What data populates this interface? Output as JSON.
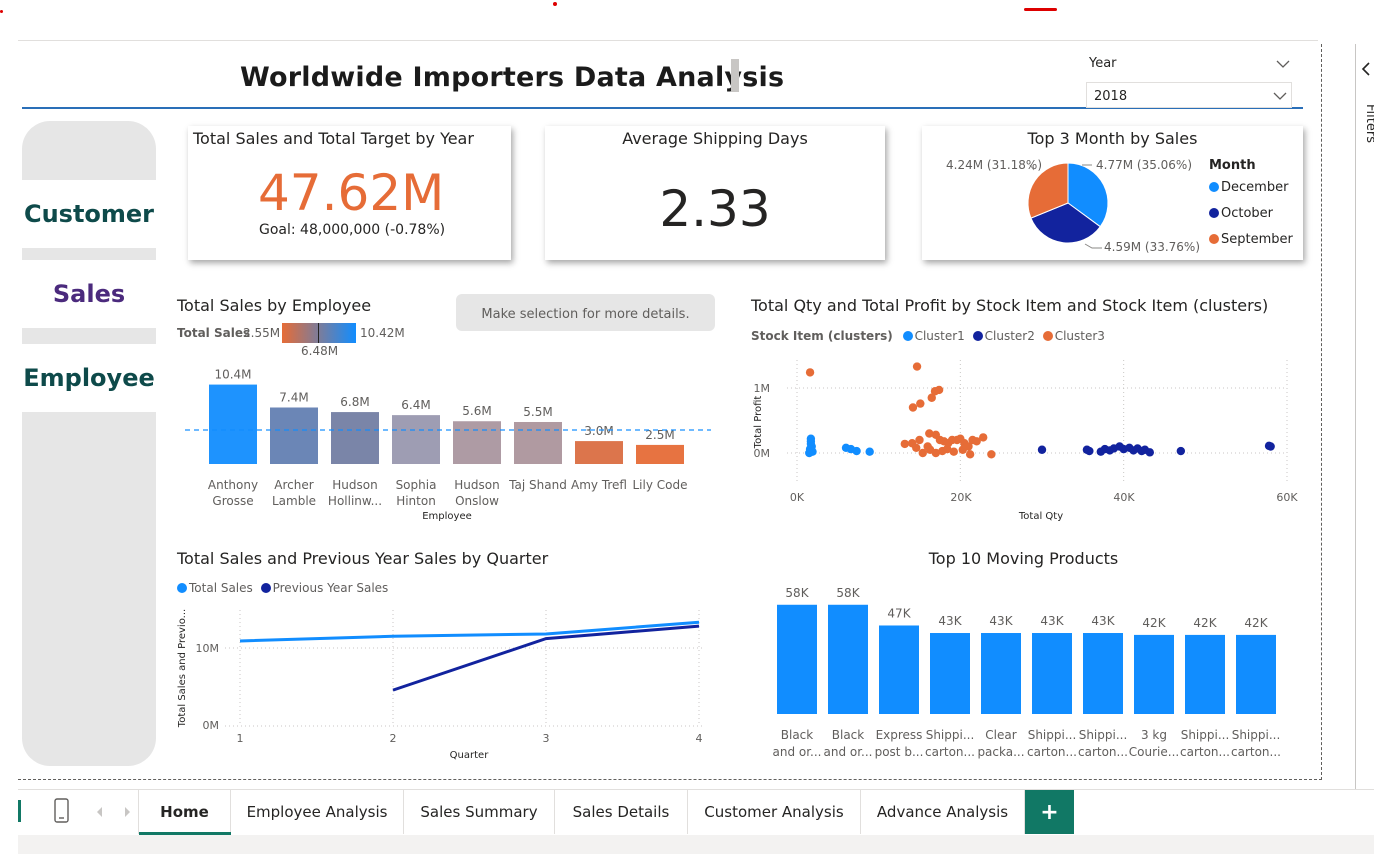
{
  "report": {
    "title": "Worldwide Importers Data Analysis"
  },
  "year_slicer": {
    "label": "Year",
    "value": "2018"
  },
  "nav": {
    "customer": "Customer",
    "sales": "Sales",
    "employee": "Employee"
  },
  "colors": {
    "accent_blue": "#118dff",
    "dark_blue": "#12239e",
    "orange": "#e66c37",
    "header_line": "#2a6fb8",
    "nav_dark": "#0e4a4a",
    "nav_purple": "#4b2a7d",
    "add_tab": "#117865"
  },
  "kpi_sales": {
    "title": "Total Sales and Total Target by Year",
    "value": "47.62M",
    "alert": "!",
    "goal": "Goal: 48,000,000 (-0.78%)"
  },
  "kpi_shipping": {
    "title": "Average Shipping Days",
    "value": "2.33"
  },
  "top3": {
    "title": "Top 3 Month by Sales",
    "legend_title": "Month",
    "legend": [
      "December",
      "October",
      "September"
    ],
    "labels": [
      "4.77M (35.06%)",
      "4.59M (33.76%)",
      "4.24M (31.18%)"
    ]
  },
  "employee_chart": {
    "title": "Total Sales by Employee",
    "grad_label": "Total Sales",
    "grad_min": "2.55M",
    "grad_mid": "6.48M",
    "grad_max": "10.42M",
    "xlabel": "Employee",
    "data_labels": [
      "10.4M",
      "7.4M",
      "6.8M",
      "6.4M",
      "5.6M",
      "5.5M",
      "3.0M",
      "2.5M"
    ],
    "names_line1": [
      "Anthony",
      "Archer",
      "Hudson",
      "Sophia",
      "Hudson",
      "Taj Shand",
      "Amy Trefl",
      "Lily Code"
    ],
    "names_line2": [
      "Grosse",
      "Lamble",
      "Hollinw...",
      "Hinton",
      "Onslow",
      "",
      "",
      ""
    ]
  },
  "selection_hint": "Make selection for more details.",
  "scatter": {
    "title": "Total Qty and Total Profit by Stock Item and Stock Item (clusters)",
    "legend_title": "Stock Item (clusters)",
    "legend": [
      "Cluster1",
      "Cluster2",
      "Cluster3"
    ],
    "xlabel": "Total Qty",
    "ylabel": "Total Profit",
    "xticks": [
      "0K",
      "20K",
      "40K",
      "60K"
    ],
    "yticks": [
      "1M",
      "0M"
    ]
  },
  "quarter_chart": {
    "title": "Total Sales and Previous Year Sales by Quarter",
    "legend": [
      "Total Sales",
      "Previous Year Sales"
    ],
    "xlabel": "Quarter",
    "ylabel": "Total Sales and Previo...",
    "xticks": [
      "1",
      "2",
      "3",
      "4"
    ],
    "yticks": [
      "10M",
      "0M"
    ]
  },
  "top10": {
    "title": "Top 10 Moving Products",
    "data_labels": [
      "58K",
      "58K",
      "47K",
      "43K",
      "43K",
      "43K",
      "43K",
      "42K",
      "42K",
      "42K"
    ],
    "names_line1": [
      "Black",
      "Black",
      "Express",
      "Shippi...",
      "Clear",
      "Shippi...",
      "Shippi...",
      "3 kg",
      "Shippi...",
      "Shippi..."
    ],
    "names_line2": [
      "and or...",
      "and or...",
      "post b...",
      "carton...",
      "packa...",
      "carton...",
      "carton...",
      "Courie...",
      "carton...",
      "carton..."
    ]
  },
  "tabs": [
    "Home",
    "Employee Analysis",
    "Sales Summary",
    "Sales Details",
    "Customer Analysis",
    "Advance Analysis"
  ],
  "add_tab_label": "+",
  "filters_label": "Filters",
  "chart_data": [
    {
      "type": "bar",
      "title": "Total Sales by Employee",
      "xlabel": "Employee",
      "categories": [
        "Anthony Grosse",
        "Archer Lamble",
        "Hudson Hollinw...",
        "Sophia Hinton",
        "Hudson Onslow",
        "Taj Shand",
        "Amy Trefl",
        "Lily Code"
      ],
      "values": [
        10.4,
        7.4,
        6.8,
        6.4,
        5.6,
        5.5,
        3.0,
        2.5
      ],
      "unit": "M",
      "average_line": 5.9,
      "ylim": [
        0,
        11
      ]
    },
    {
      "type": "pie",
      "title": "Top 3 Month by Sales",
      "categories": [
        "December",
        "October",
        "September"
      ],
      "values": [
        4.77,
        4.59,
        4.24
      ],
      "percents": [
        35.06,
        33.76,
        31.18
      ],
      "colors": [
        "#118dff",
        "#12239e",
        "#e66c37"
      ]
    },
    {
      "type": "scatter",
      "title": "Total Qty and Total Profit by Stock Item and Stock Item (clusters)",
      "xlabel": "Total Qty",
      "ylabel": "Total Profit",
      "xlim": [
        0,
        60000
      ],
      "ylim": [
        -0.1,
        1.3
      ],
      "series": [
        {
          "name": "Cluster1",
          "color": "#118dff",
          "points": [
            [
              1700,
              0.22
            ],
            [
              1700,
              0.18
            ],
            [
              1700,
              0.14
            ],
            [
              1800,
              0.1
            ],
            [
              1600,
              0.06
            ],
            [
              1900,
              0.02
            ],
            [
              1500,
              0.0
            ],
            [
              6000,
              0.08
            ],
            [
              6600,
              0.06
            ],
            [
              7300,
              0.03
            ],
            [
              8900,
              0.02
            ]
          ]
        },
        {
          "name": "Cluster2",
          "color": "#12239e",
          "points": [
            [
              30000,
              0.05
            ],
            [
              35500,
              0.05
            ],
            [
              35800,
              0.03
            ],
            [
              37200,
              0.02
            ],
            [
              37700,
              0.06
            ],
            [
              38300,
              0.04
            ],
            [
              38800,
              0.07
            ],
            [
              39500,
              0.1
            ],
            [
              40000,
              0.06
            ],
            [
              40700,
              0.08
            ],
            [
              41200,
              0.04
            ],
            [
              41700,
              0.07
            ],
            [
              42200,
              0.03
            ],
            [
              42600,
              0.05
            ],
            [
              43200,
              0.01
            ],
            [
              47000,
              0.03
            ],
            [
              57800,
              0.11
            ],
            [
              58000,
              0.1
            ]
          ]
        },
        {
          "name": "Cluster3",
          "color": "#e66c37",
          "points": [
            [
              1600,
              1.24
            ],
            [
              14700,
              1.33
            ],
            [
              14200,
              0.7
            ],
            [
              15100,
              0.76
            ],
            [
              16500,
              0.85
            ],
            [
              16900,
              0.95
            ],
            [
              17400,
              0.97
            ],
            [
              16200,
              0.3
            ],
            [
              15000,
              0.2
            ],
            [
              13200,
              0.14
            ],
            [
              14100,
              0.15
            ],
            [
              16000,
              0.1
            ],
            [
              17000,
              0.28
            ],
            [
              17500,
              0.2
            ],
            [
              18000,
              0.18
            ],
            [
              18500,
              0.15
            ],
            [
              19000,
              0.2
            ],
            [
              19600,
              0.2
            ],
            [
              20000,
              0.22
            ],
            [
              20500,
              0.15
            ],
            [
              21000,
              0.1
            ],
            [
              21500,
              0.2
            ],
            [
              22000,
              0.18
            ],
            [
              22800,
              0.24
            ],
            [
              16300,
              0.05
            ],
            [
              17000,
              0.0
            ],
            [
              17800,
              0.03
            ],
            [
              18400,
              0.06
            ],
            [
              19200,
              0.02
            ],
            [
              20300,
              0.05
            ],
            [
              21200,
              -0.02
            ],
            [
              23800,
              -0.02
            ],
            [
              15400,
              0.0
            ],
            [
              14600,
              0.08
            ]
          ]
        }
      ]
    },
    {
      "type": "line",
      "title": "Total Sales and Previous Year Sales by Quarter",
      "xlabel": "Quarter",
      "ylabel": "Total Sales and Previo...",
      "categories": [
        "1",
        "2",
        "3",
        "4"
      ],
      "ylim": [
        0,
        14.5
      ],
      "series": [
        {
          "name": "Total Sales",
          "color": "#118dff",
          "values": [
            10.9,
            11.5,
            11.8,
            13.3
          ]
        },
        {
          "name": "Previous Year Sales",
          "color": "#12239e",
          "values": [
            null,
            4.6,
            11.2,
            12.8
          ]
        }
      ]
    },
    {
      "type": "bar",
      "title": "Top 10 Moving Products",
      "categories": [
        "Black and or...",
        "Black and or...",
        "Express post b...",
        "Shippi... carton...",
        "Clear packa...",
        "Shippi... carton...",
        "Shippi... carton...",
        "3 kg Courie...",
        "Shippi... carton...",
        "Shippi... carton..."
      ],
      "values": [
        58,
        58,
        47,
        43,
        43,
        43,
        43,
        42,
        42,
        42
      ],
      "unit": "K",
      "ylim": [
        0,
        60
      ]
    }
  ]
}
